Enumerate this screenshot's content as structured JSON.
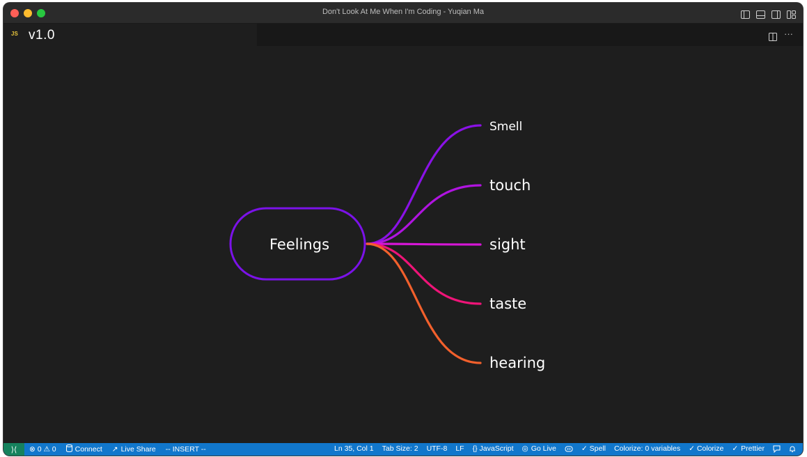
{
  "window": {
    "title": "Don't Look At Me When I'm Coding - Yuqian Ma"
  },
  "tab": {
    "icon_label": "JS",
    "label": "v1.0"
  },
  "editor_actions": {
    "more_label": "···"
  },
  "mindmap": {
    "root": "Feelings",
    "branches": [
      {
        "label": "Smell",
        "color": "#8a12e6"
      },
      {
        "label": "touch",
        "color": "#b014e0"
      },
      {
        "label": "sight",
        "color": "#d516d6"
      },
      {
        "label": "taste",
        "color": "#ee1478"
      },
      {
        "label": "hearing",
        "color": "#f2602c"
      }
    ],
    "root_border_color": "#7b12e8"
  },
  "statusbar": {
    "remote_icon": "remote-icon",
    "problems": "⊗ 0 ⚠ 0",
    "connect": "Connect",
    "live_share": "Live Share",
    "mode": "-- INSERT --",
    "position": "Ln 35, Col 1",
    "tab_size": "Tab Size: 2",
    "encoding": "UTF-8",
    "eol": "LF",
    "language": "{} JavaScript",
    "go_live": "Go Live",
    "spell": "✓ Spell",
    "colorize_vars": "Colorize: 0 variables",
    "colorize": "✓ Colorize",
    "prettier": "Prettier"
  },
  "colors": {
    "statusbar_bg": "#1177cc",
    "remote_bg": "#16825d",
    "editor_bg": "#1e1e1e"
  }
}
